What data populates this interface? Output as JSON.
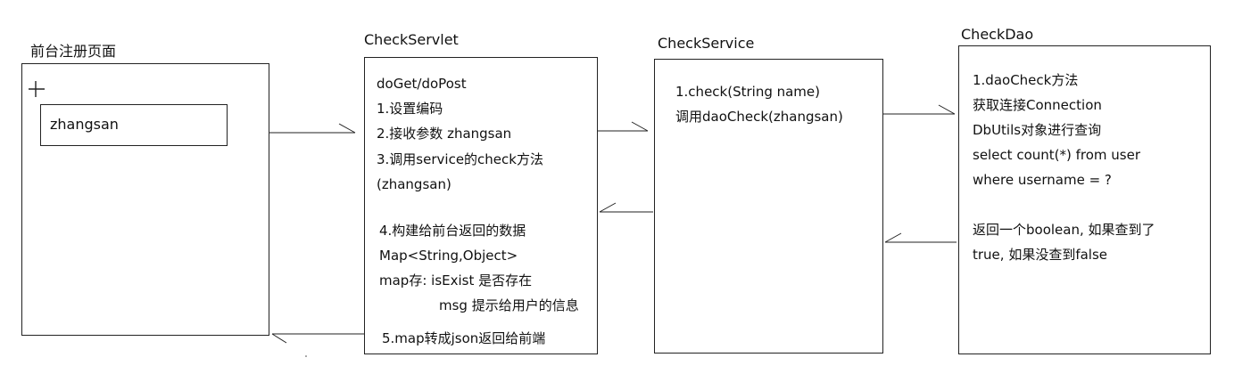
{
  "frontend": {
    "title": "前台注册页面",
    "input_value": "zhangsan"
  },
  "servlet": {
    "title": "CheckServlet",
    "lines": [
      "doGet/doPost",
      "1.设置编码",
      "2.接收参数 zhangsan",
      "3.调用service的check方法",
      "(zhangsan)",
      "4.构建给前台返回的数据",
      "Map<String,Object>",
      "map存:  isExist   是否存在",
      "msg    提示给用户的信息",
      "5.map转成json返回给前端"
    ]
  },
  "service": {
    "title": "CheckService",
    "lines": [
      "1.check(String name)",
      "调用daoCheck(zhangsan)"
    ]
  },
  "dao": {
    "title": "CheckDao",
    "lines": [
      "1.daoCheck方法",
      "获取连接Connection",
      "DbUtils对象进行查询",
      "select count(*) from user",
      "where username = ?",
      "返回一个boolean, 如果查到了",
      "true, 如果没查到false"
    ]
  },
  "colors": {
    "stroke": "#222222",
    "background": "#ffffff"
  }
}
